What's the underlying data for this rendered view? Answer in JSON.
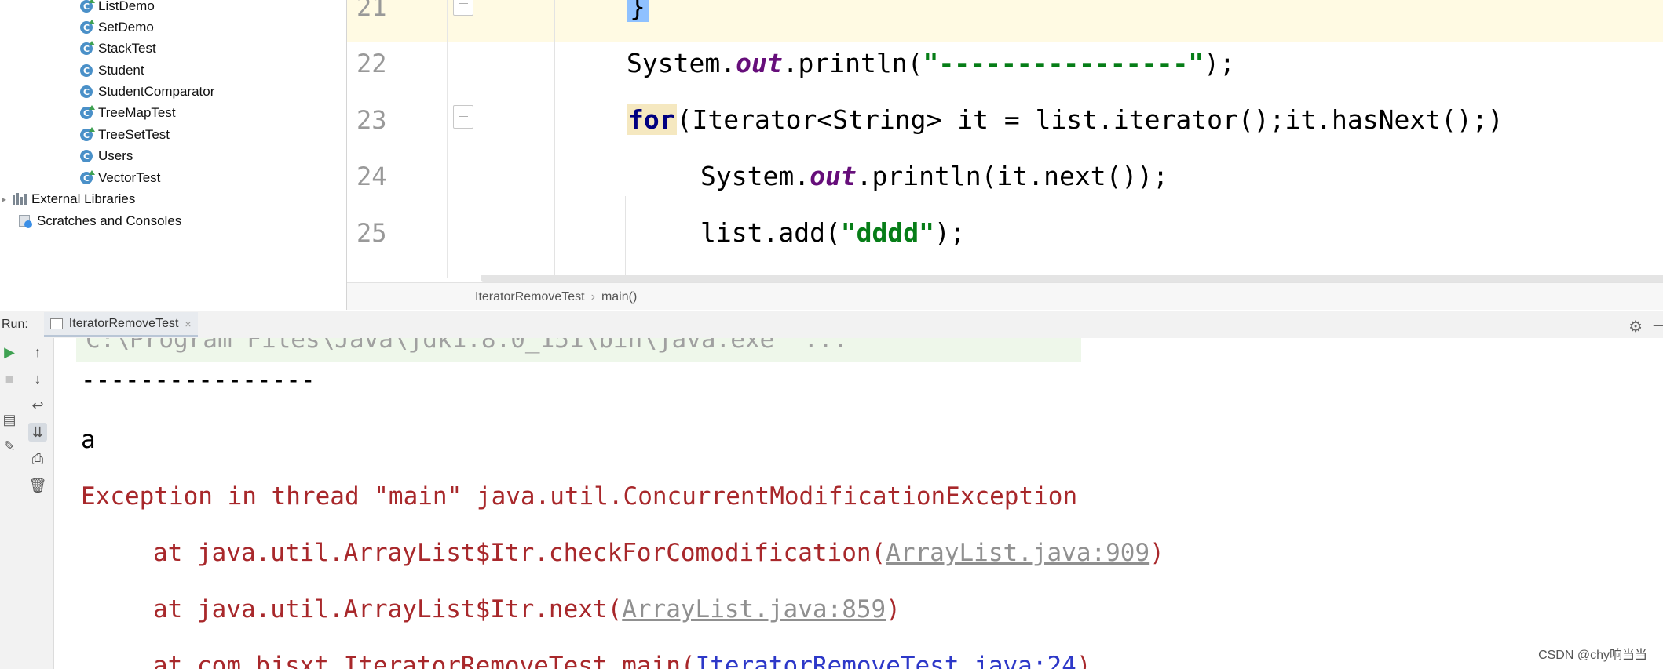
{
  "project_tree": {
    "classes": [
      {
        "label": "ListDemo",
        "runnable": true
      },
      {
        "label": "SetDemo",
        "runnable": true
      },
      {
        "label": "StackTest",
        "runnable": true
      },
      {
        "label": "Student",
        "runnable": false
      },
      {
        "label": "StudentComparator",
        "runnable": false
      },
      {
        "label": "TreeMapTest",
        "runnable": true
      },
      {
        "label": "TreeSetTest",
        "runnable": true
      },
      {
        "label": "Users",
        "runnable": false
      },
      {
        "label": "VectorTest",
        "runnable": true
      }
    ],
    "class_icon_letter": "C",
    "external_libraries": "External Libraries",
    "scratches": "Scratches and Consoles"
  },
  "editor": {
    "lines": [
      {
        "number": "21",
        "current": true
      },
      {
        "number": "22",
        "current": false
      },
      {
        "number": "23",
        "current": false
      },
      {
        "number": "24",
        "current": false
      },
      {
        "number": "25",
        "current": false
      }
    ],
    "code": {
      "l21_brace": "}",
      "l22_system": "System.",
      "l22_out": "out",
      "l22_println": ".println(",
      "l22_string": "\"----------------\"",
      "l22_end": ");",
      "l23_for": "for",
      "l23_rest": "(Iterator<String> it = list.iterator();it.hasNext();)",
      "l24_system": "System.",
      "l24_out": "out",
      "l24_rest": ".println(it.next());",
      "l25_start": "list.add(",
      "l25_string": "\"dddd\"",
      "l25_end": ");"
    },
    "breadcrumb": [
      "IteratorRemoveTest",
      "main()"
    ]
  },
  "run_panel": {
    "label": "Run:",
    "tab_name": "IteratorRemoveTest",
    "tab_close": "×",
    "console": {
      "cut_line": "C:\\Program Files\\Java\\jdk1.8.0_151\\bin\\java.exe\" ...",
      "separator": "----------------",
      "value_a": "a",
      "exception_line": "Exception in thread \"main\" java.util.ConcurrentModificationException",
      "trace": [
        {
          "prefix": "at java.util.ArrayList$Itr.checkForComodification(",
          "link": "ArrayList.java:909",
          "suffix": ")",
          "link_style": "gray"
        },
        {
          "prefix": "at java.util.ArrayList$Itr.next(",
          "link": "ArrayList.java:859",
          "suffix": ")",
          "link_style": "gray"
        },
        {
          "prefix": "at com.bjsxt.IteratorRemoveTest.main(",
          "link": "IteratorRemoveTest.java:24",
          "suffix": ")",
          "link_style": "blue"
        }
      ]
    }
  },
  "watermark": "CSDN @chy响当当",
  "colors": {
    "keyword": "#000080",
    "static_field": "#660e7a",
    "string": "#067d17",
    "error_text": "#a8282b",
    "link_blue": "#2d38c8",
    "caret_line": "#fffae3"
  }
}
